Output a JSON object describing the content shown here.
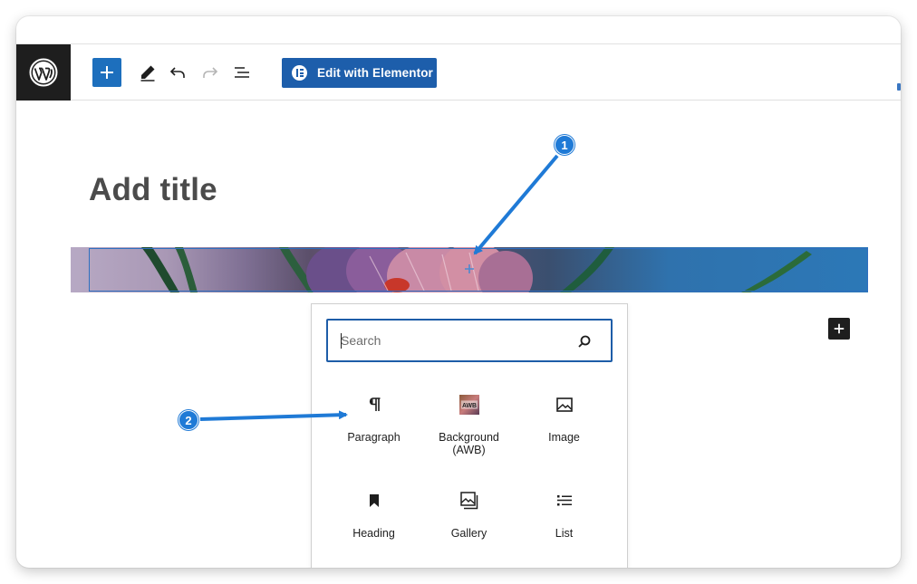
{
  "toolbar": {
    "elementor_label": "Edit with Elementor",
    "icons": {
      "logo": "wordpress-logo-icon",
      "inserter": "plus-icon",
      "tools": "pencil-icon",
      "undo": "undo-icon",
      "redo": "redo-icon",
      "list_view": "list-view-icon",
      "elementor": "elementor-icon"
    }
  },
  "editor": {
    "title": "Add title"
  },
  "inserter": {
    "search_placeholder": "Search",
    "blocks": [
      {
        "label": "Paragraph",
        "icon": "paragraph-icon"
      },
      {
        "label": "Background (AWB)",
        "label_line1": "Background",
        "label_line2": "(AWB)",
        "icon": "awb-icon",
        "icon_text": "AWB"
      },
      {
        "label": "Image",
        "icon": "image-icon"
      },
      {
        "label": "Heading",
        "icon": "heading-icon"
      },
      {
        "label": "Gallery",
        "icon": "gallery-icon"
      },
      {
        "label": "List",
        "icon": "list-icon"
      }
    ]
  },
  "annotations": {
    "callout_1": "1",
    "callout_2": "2",
    "color": "#1f7ad6"
  },
  "colors": {
    "primary": "#1d6fbd",
    "elementor": "#1d5eab",
    "dark": "#1e1e1e",
    "title": "#4b4b4b"
  }
}
